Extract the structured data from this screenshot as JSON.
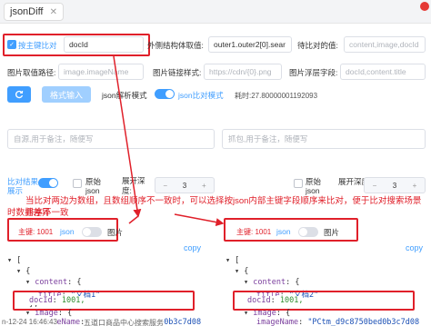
{
  "tab": {
    "title": "jsonDiff",
    "close_label": "✕"
  },
  "row1": {
    "primary_key_compare_label": "按主键比对",
    "primary_key_value": "docId",
    "outer_structure_label": "外侧结构体取值:",
    "outer_structure_value": "outer1.outer2[0].sear",
    "compare_value_label": "待比对的值:",
    "compare_value_placeholder": "content,image,docId"
  },
  "row2": {
    "image_path_label": "图片取值路径:",
    "image_path_placeholder": "image.imageName",
    "image_link_label": "图片链接样式:",
    "image_link_placeholder": "https://cdn/{0}.png",
    "image_float_label": "图片浮层字段:",
    "image_float_placeholder": "docId,content.title"
  },
  "row3": {
    "refresh_icon": "refresh-icon",
    "format_button_label": "格式输入",
    "json_parse_label": "json解析模式",
    "json_compare_label": "json比对模式",
    "elapsed_text": "耗时:27.80000001192093"
  },
  "textareas": {
    "left_placeholder": "自源,用于备注，随便写",
    "right_placeholder": "抓包,用于备注，随便写"
  },
  "left_panel": {
    "compare_result_label": "比对结果",
    "show_label": "展示",
    "raw_json_label": "原始",
    "raw_json_label2": "json",
    "expand_depth_label": "展开深",
    "expand_depth_label2": "度:",
    "expand_depth_value": "3",
    "key_tag": "主键: 1001",
    "json_label": "json",
    "image_label": "图片",
    "copy_label": "copy"
  },
  "right_panel": {
    "raw_json_label": "原始",
    "raw_json_label2": "json",
    "expand_depth_label": "展开深度:",
    "expand_depth_value": "3",
    "key_tag": "主键: 1001",
    "json_label": "json",
    "image_label": "图片",
    "copy_label": "copy"
  },
  "annotation": {
    "line1": "当比对两边为数组，且数组顺序不一致时，可以选择按json内部主键字段顺序来比对，便于比对搜索场景排序不一致",
    "line2": "时数据差异"
  },
  "left_code": {
    "l1": "[",
    "l2": "{",
    "l3_key": "content",
    "l4_key": "title",
    "l4_val": "\"文档1\"",
    "l5": "},",
    "l6_key": "docId",
    "l6_val": "1001,",
    "l7_key": "image",
    "l8_key": "imageName",
    "l8_val": "\"PCtm_d9c8750bed0b3c7d08"
  },
  "right_code": {
    "l1": "[",
    "l2": "{",
    "l3_key": "content",
    "l4_key": "title",
    "l4_val": "\"文档2\"",
    "l5": "},",
    "l6_key": "docId",
    "l6_val": "1001,",
    "l7_key": "image",
    "l8_key": "imageName",
    "l8_val": "\"PCtm_d9c8750bed0b3c7d08"
  },
  "footer": {
    "date_text": "n-12-24 16:46:43",
    "bottom_text": "五道口商品中心搜索服务"
  },
  "colors": {
    "accent": "#409eff",
    "annotation_red": "#e0202a"
  }
}
